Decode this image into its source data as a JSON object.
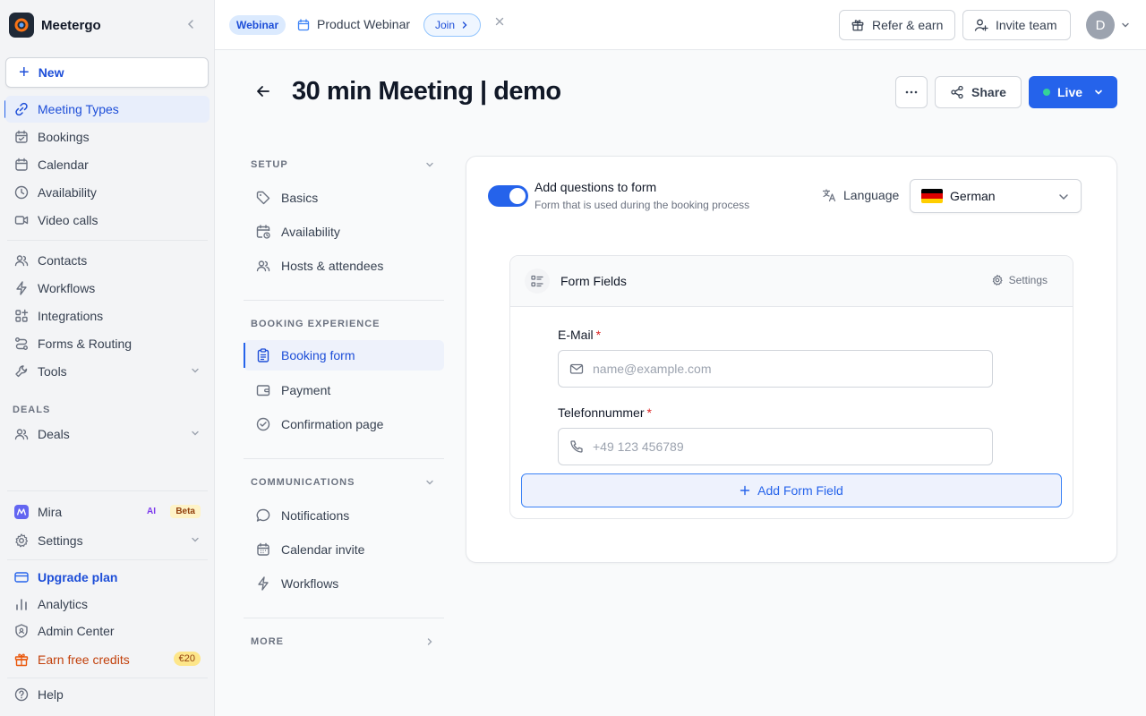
{
  "app": {
    "name": "Meetergo"
  },
  "sidebar": {
    "new_label": "New",
    "items": [
      {
        "label": "Meeting Types",
        "icon": "link-icon"
      },
      {
        "label": "Bookings",
        "icon": "calendar-check-icon"
      },
      {
        "label": "Calendar",
        "icon": "calendar-icon"
      },
      {
        "label": "Availability",
        "icon": "clock-icon"
      },
      {
        "label": "Video calls",
        "icon": "video-icon"
      },
      {
        "label": "Contacts",
        "icon": "users-icon"
      },
      {
        "label": "Workflows",
        "icon": "bolt-icon"
      },
      {
        "label": "Integrations",
        "icon": "grid-plus-icon"
      },
      {
        "label": "Forms & Routing",
        "icon": "route-icon"
      },
      {
        "label": "Tools",
        "icon": "wrench-icon"
      },
      {
        "label": "Deals",
        "icon": "users-icon"
      },
      {
        "label": "Mira",
        "icon": "mira-icon"
      },
      {
        "label": "Settings",
        "icon": "gear-icon"
      },
      {
        "label": "Upgrade plan",
        "icon": "credit-card-icon"
      },
      {
        "label": "Analytics",
        "icon": "bar-chart-icon"
      },
      {
        "label": "Admin Center",
        "icon": "shield-icon"
      },
      {
        "label": "Earn free credits",
        "icon": "gift-icon"
      },
      {
        "label": "Help",
        "icon": "help-icon"
      }
    ],
    "deals_section": "DEALS",
    "ai_tag": "AI",
    "beta_tag": "Beta",
    "credit_tag": "€20"
  },
  "topbar": {
    "webinar_badge": "Webinar",
    "webinar_title": "Product Webinar",
    "join_label": "Join",
    "refer_label": "Refer & earn",
    "invite_label": "Invite team",
    "avatar_initial": "D"
  },
  "header": {
    "title": "30 min Meeting | demo",
    "share_label": "Share",
    "live_label": "Live"
  },
  "subnav": {
    "setup_section": "SETUP",
    "setup_items": [
      "Basics",
      "Availability",
      "Hosts & attendees"
    ],
    "booking_section": "BOOKING EXPERIENCE",
    "booking_items": [
      "Booking form",
      "Payment",
      "Confirmation page"
    ],
    "comm_section": "COMMUNICATIONS",
    "comm_items": [
      "Notifications",
      "Calendar invite",
      "Workflows"
    ],
    "more_section": "MORE"
  },
  "form": {
    "toggle_title": "Add questions to form",
    "toggle_subtitle": "Form that is used during the booking process",
    "toggle_on": true,
    "language_label": "Language",
    "language_value": "German",
    "panel_title": "Form Fields",
    "settings_label": "Settings",
    "fields": [
      {
        "label": "E-Mail",
        "required": "*",
        "placeholder": "name@example.com"
      },
      {
        "label": "Telefonnummer",
        "required": "*",
        "placeholder": "+49 123 456789"
      }
    ],
    "add_field_label": "Add Form Field"
  },
  "colors": {
    "accent": "#2563eb",
    "live_dot": "#34d399"
  }
}
